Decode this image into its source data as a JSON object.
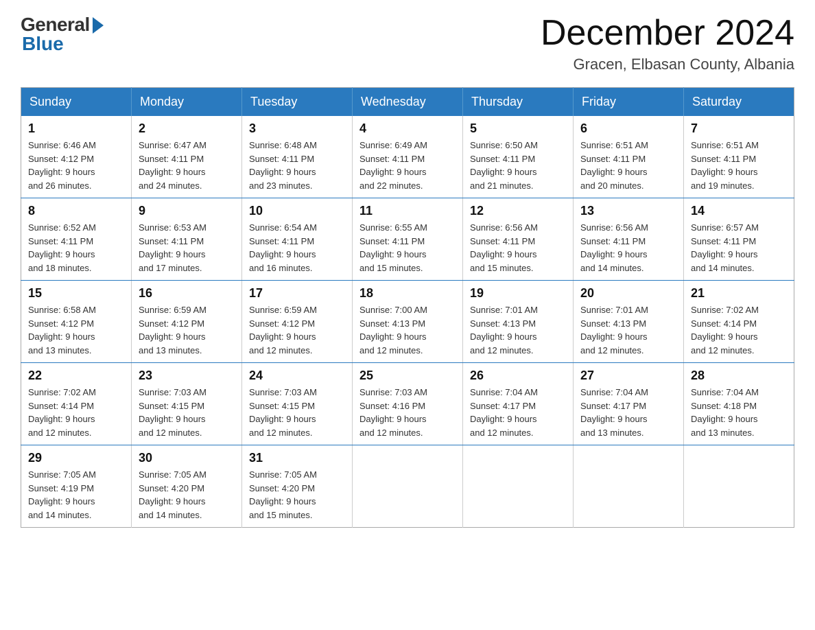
{
  "logo": {
    "general": "General",
    "blue": "Blue"
  },
  "title": {
    "month_year": "December 2024",
    "location": "Gracen, Elbasan County, Albania"
  },
  "days_of_week": [
    "Sunday",
    "Monday",
    "Tuesday",
    "Wednesday",
    "Thursday",
    "Friday",
    "Saturday"
  ],
  "weeks": [
    [
      {
        "day": "1",
        "sunrise": "6:46 AM",
        "sunset": "4:12 PM",
        "daylight": "9 hours and 26 minutes."
      },
      {
        "day": "2",
        "sunrise": "6:47 AM",
        "sunset": "4:11 PM",
        "daylight": "9 hours and 24 minutes."
      },
      {
        "day": "3",
        "sunrise": "6:48 AM",
        "sunset": "4:11 PM",
        "daylight": "9 hours and 23 minutes."
      },
      {
        "day": "4",
        "sunrise": "6:49 AM",
        "sunset": "4:11 PM",
        "daylight": "9 hours and 22 minutes."
      },
      {
        "day": "5",
        "sunrise": "6:50 AM",
        "sunset": "4:11 PM",
        "daylight": "9 hours and 21 minutes."
      },
      {
        "day": "6",
        "sunrise": "6:51 AM",
        "sunset": "4:11 PM",
        "daylight": "9 hours and 20 minutes."
      },
      {
        "day": "7",
        "sunrise": "6:51 AM",
        "sunset": "4:11 PM",
        "daylight": "9 hours and 19 minutes."
      }
    ],
    [
      {
        "day": "8",
        "sunrise": "6:52 AM",
        "sunset": "4:11 PM",
        "daylight": "9 hours and 18 minutes."
      },
      {
        "day": "9",
        "sunrise": "6:53 AM",
        "sunset": "4:11 PM",
        "daylight": "9 hours and 17 minutes."
      },
      {
        "day": "10",
        "sunrise": "6:54 AM",
        "sunset": "4:11 PM",
        "daylight": "9 hours and 16 minutes."
      },
      {
        "day": "11",
        "sunrise": "6:55 AM",
        "sunset": "4:11 PM",
        "daylight": "9 hours and 15 minutes."
      },
      {
        "day": "12",
        "sunrise": "6:56 AM",
        "sunset": "4:11 PM",
        "daylight": "9 hours and 15 minutes."
      },
      {
        "day": "13",
        "sunrise": "6:56 AM",
        "sunset": "4:11 PM",
        "daylight": "9 hours and 14 minutes."
      },
      {
        "day": "14",
        "sunrise": "6:57 AM",
        "sunset": "4:11 PM",
        "daylight": "9 hours and 14 minutes."
      }
    ],
    [
      {
        "day": "15",
        "sunrise": "6:58 AM",
        "sunset": "4:12 PM",
        "daylight": "9 hours and 13 minutes."
      },
      {
        "day": "16",
        "sunrise": "6:59 AM",
        "sunset": "4:12 PM",
        "daylight": "9 hours and 13 minutes."
      },
      {
        "day": "17",
        "sunrise": "6:59 AM",
        "sunset": "4:12 PM",
        "daylight": "9 hours and 12 minutes."
      },
      {
        "day": "18",
        "sunrise": "7:00 AM",
        "sunset": "4:13 PM",
        "daylight": "9 hours and 12 minutes."
      },
      {
        "day": "19",
        "sunrise": "7:01 AM",
        "sunset": "4:13 PM",
        "daylight": "9 hours and 12 minutes."
      },
      {
        "day": "20",
        "sunrise": "7:01 AM",
        "sunset": "4:13 PM",
        "daylight": "9 hours and 12 minutes."
      },
      {
        "day": "21",
        "sunrise": "7:02 AM",
        "sunset": "4:14 PM",
        "daylight": "9 hours and 12 minutes."
      }
    ],
    [
      {
        "day": "22",
        "sunrise": "7:02 AM",
        "sunset": "4:14 PM",
        "daylight": "9 hours and 12 minutes."
      },
      {
        "day": "23",
        "sunrise": "7:03 AM",
        "sunset": "4:15 PM",
        "daylight": "9 hours and 12 minutes."
      },
      {
        "day": "24",
        "sunrise": "7:03 AM",
        "sunset": "4:15 PM",
        "daylight": "9 hours and 12 minutes."
      },
      {
        "day": "25",
        "sunrise": "7:03 AM",
        "sunset": "4:16 PM",
        "daylight": "9 hours and 12 minutes."
      },
      {
        "day": "26",
        "sunrise": "7:04 AM",
        "sunset": "4:17 PM",
        "daylight": "9 hours and 12 minutes."
      },
      {
        "day": "27",
        "sunrise": "7:04 AM",
        "sunset": "4:17 PM",
        "daylight": "9 hours and 13 minutes."
      },
      {
        "day": "28",
        "sunrise": "7:04 AM",
        "sunset": "4:18 PM",
        "daylight": "9 hours and 13 minutes."
      }
    ],
    [
      {
        "day": "29",
        "sunrise": "7:05 AM",
        "sunset": "4:19 PM",
        "daylight": "9 hours and 14 minutes."
      },
      {
        "day": "30",
        "sunrise": "7:05 AM",
        "sunset": "4:20 PM",
        "daylight": "9 hours and 14 minutes."
      },
      {
        "day": "31",
        "sunrise": "7:05 AM",
        "sunset": "4:20 PM",
        "daylight": "9 hours and 15 minutes."
      },
      null,
      null,
      null,
      null
    ]
  ],
  "labels": {
    "sunrise": "Sunrise:",
    "sunset": "Sunset:",
    "daylight": "Daylight:"
  }
}
